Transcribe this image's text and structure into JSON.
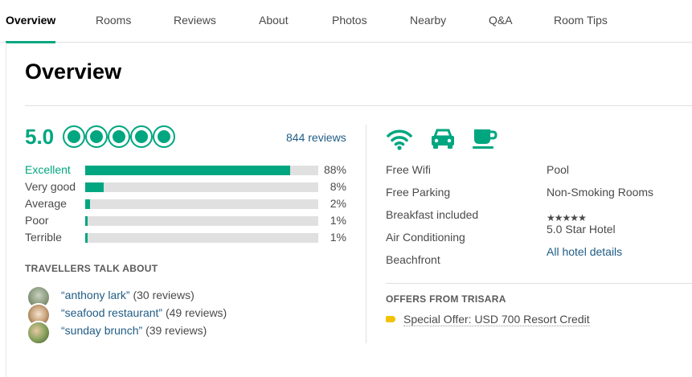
{
  "tabs": [
    "Overview",
    "Rooms",
    "Reviews",
    "About",
    "Photos",
    "Nearby",
    "Q&A",
    "Room Tips"
  ],
  "page_title": "Overview",
  "rating": {
    "score": "5.0",
    "bubbles": 5,
    "review_count": "844 reviews",
    "breakdown": [
      {
        "label": "Excellent",
        "pct_text": "88%",
        "value": 88
      },
      {
        "label": "Very good",
        "pct_text": "8%",
        "value": 8
      },
      {
        "label": "Average",
        "pct_text": "2%",
        "value": 2
      },
      {
        "label": "Poor",
        "pct_text": "1%",
        "value": 1
      },
      {
        "label": "Terrible",
        "pct_text": "1%",
        "value": 1
      }
    ]
  },
  "travellers": {
    "heading": "TRAVELLERS TALK ABOUT",
    "items": [
      {
        "keyword": "“anthony lark”",
        "count": "(30 reviews)"
      },
      {
        "keyword": "“seafood restaurant”",
        "count": "(49 reviews)"
      },
      {
        "keyword": "“sunday brunch”",
        "count": "(39 reviews)"
      }
    ]
  },
  "amenities": {
    "icons": [
      "wifi-icon",
      "car-icon",
      "coffee-cup-icon"
    ],
    "col1": [
      "Free Wifi",
      "Free Parking",
      "Breakfast included",
      "Air Conditioning",
      "Beachfront"
    ],
    "col2": [
      "Pool",
      "Non-Smoking Rooms"
    ],
    "star_rating": 5,
    "star_text": "5.0 Star Hotel",
    "details_link": "All hotel details"
  },
  "offers": {
    "heading": "OFFERS FROM TRISARA",
    "special": "Special Offer: USD 700 Resort Credit"
  },
  "colors": {
    "accent": "#00a680",
    "link": "#1f5c84",
    "offer_tag": "#f2c200"
  }
}
